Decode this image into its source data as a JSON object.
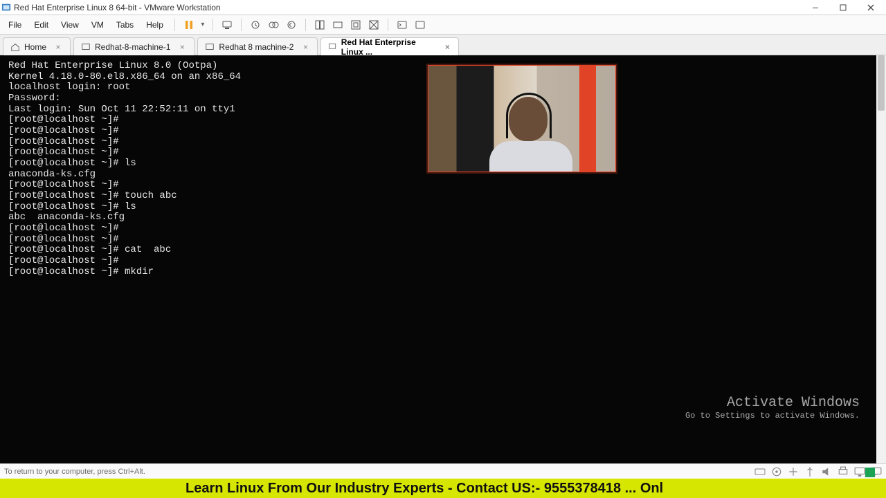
{
  "window": {
    "title": "Red Hat Enterprise Linux 8 64-bit - VMware Workstation"
  },
  "menu": {
    "file": "File",
    "edit": "Edit",
    "view": "View",
    "vm": "VM",
    "tabs": "Tabs",
    "help": "Help"
  },
  "tabs": [
    {
      "label": "Home"
    },
    {
      "label": "Redhat-8-machine-1"
    },
    {
      "label": "Redhat 8 machine-2"
    },
    {
      "label": "Red Hat Enterprise Linux ..."
    }
  ],
  "console": [
    "Red Hat Enterprise Linux 8.0 (Ootpa)",
    "Kernel 4.18.0-80.el8.x86_64 on an x86_64",
    "",
    "localhost login: root",
    "Password:",
    "Last login: Sun Oct 11 22:52:11 on tty1",
    "[root@localhost ~]#",
    "[root@localhost ~]#",
    "[root@localhost ~]#",
    "[root@localhost ~]#",
    "[root@localhost ~]# ls",
    "anaconda-ks.cfg",
    "[root@localhost ~]#",
    "[root@localhost ~]# touch abc",
    "[root@localhost ~]# ls",
    "abc  anaconda-ks.cfg",
    "[root@localhost ~]#",
    "[root@localhost ~]#",
    "[root@localhost ~]# cat  abc",
    "[root@localhost ~]#",
    "[root@localhost ~]# mkdir"
  ],
  "watermark": {
    "line1": "Activate Windows",
    "line2": "Go to Settings to activate Windows."
  },
  "statusbar": {
    "hint": "To return to your computer, press Ctrl+Alt."
  },
  "marquee": {
    "text": "Learn Linux From Our Industry Experts - Contact US:- 9555378418 ... Onl"
  },
  "colors": {
    "marquee_bg": "#d7e600",
    "accent_orange": "#e04326",
    "accent_green": "#1aa354"
  }
}
